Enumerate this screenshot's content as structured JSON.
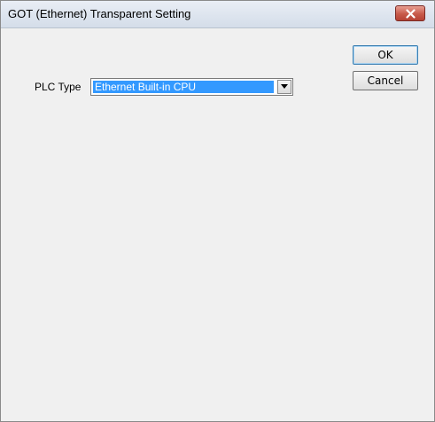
{
  "window": {
    "title": "GOT (Ethernet) Transparent Setting"
  },
  "buttons": {
    "ok_label": "OK",
    "cancel_label": "Cancel"
  },
  "plc_type": {
    "label": "PLC Type",
    "selected_value": "Ethernet Built-in CPU"
  },
  "icons": {
    "close": "close-icon",
    "dropdown": "chevron-down-icon"
  },
  "colors": {
    "selection_highlight": "#3399ff",
    "close_button": "#c75a4a"
  }
}
